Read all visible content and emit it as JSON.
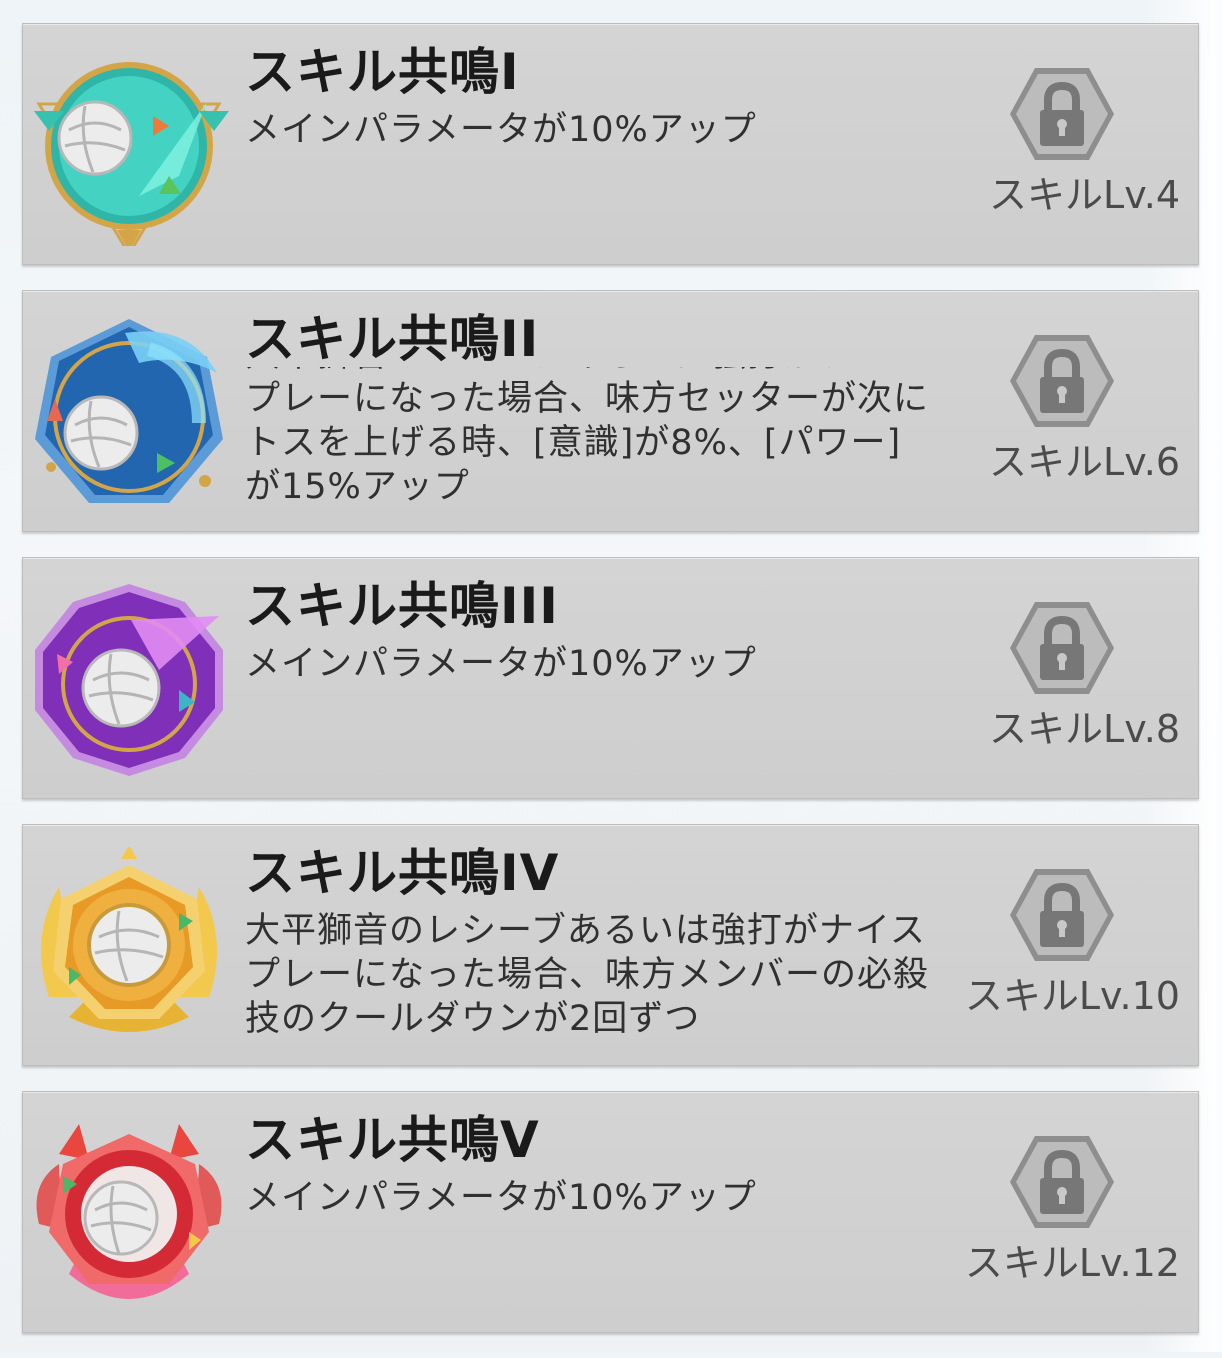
{
  "skills": [
    {
      "title": "スキル共鳴I",
      "description": "メインパラメータが10%アップ",
      "unlock_label": "スキルLv.4",
      "lock_icon": "lock-icon",
      "emblem_color": "#3cc7b4"
    },
    {
      "title": "スキル共鳴II",
      "description": "大平獅音のレシーブあるいは強打がナイスプレーになった場合、味方セッターが次にトスを上げる時、[意識]が8%、[パワー]が15%アップ",
      "unlock_label": "スキルLv.6",
      "lock_icon": "lock-icon",
      "emblem_color": "#2b78c4"
    },
    {
      "title": "スキル共鳴III",
      "description": "メインパラメータが10%アップ",
      "unlock_label": "スキルLv.8",
      "lock_icon": "lock-icon",
      "emblem_color": "#8a3fc2"
    },
    {
      "title": "スキル共鳴IV",
      "description": "大平獅音のレシーブあるいは強打がナイスプレーになった場合、味方メンバーの必殺技のクールダウンが2回ずつ",
      "unlock_label": "スキルLv.10",
      "lock_icon": "lock-icon",
      "emblem_color": "#e5a52c"
    },
    {
      "title": "スキル共鳴V",
      "description": "メインパラメータが10%アップ",
      "unlock_label": "スキルLv.12",
      "lock_icon": "lock-icon",
      "emblem_color": "#d8323b"
    }
  ]
}
